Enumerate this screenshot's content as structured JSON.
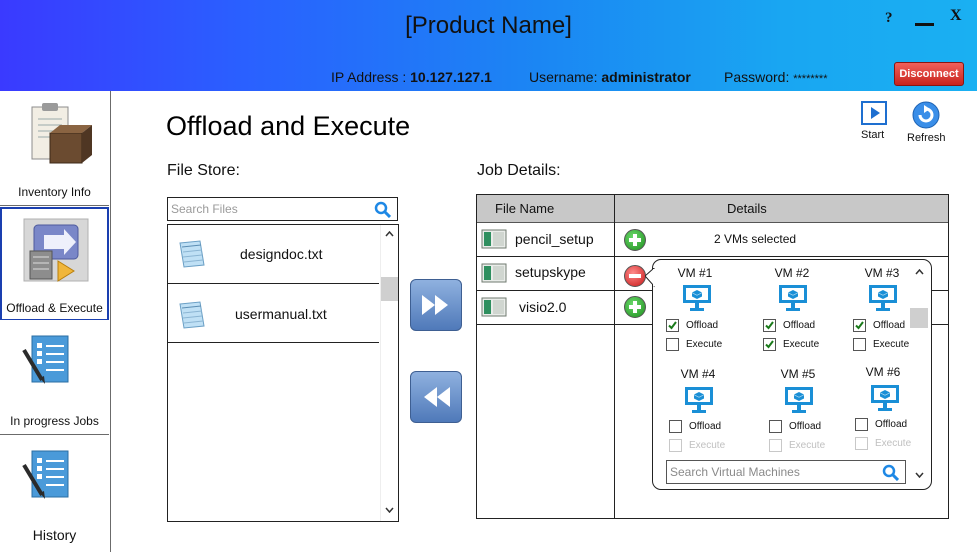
{
  "header": {
    "product_name": "[Product Name]",
    "help": "?",
    "close": "X",
    "ip_label": "IP Address :",
    "ip_value": "10.127.127.1",
    "user_label": "Username:",
    "user_value": "administrator",
    "pass_label": "Password:",
    "pass_value": "********",
    "disconnect": "Disconnect"
  },
  "sidebar": {
    "items": [
      {
        "label": "Inventory Info",
        "icon": "clipboard-box-icon"
      },
      {
        "label": "Offload & Execute",
        "icon": "server-arrow-icon"
      },
      {
        "label": "In progress Jobs",
        "icon": "checklist-pen-icon"
      },
      {
        "label": "History",
        "icon": "checklist-pen-icon"
      }
    ]
  },
  "main": {
    "title": "Offload and Execute",
    "toolbar": {
      "start": "Start",
      "refresh": "Refresh"
    },
    "file_store": {
      "label": "File Store:",
      "search_placeholder": "Search Files",
      "files": [
        "designdoc.txt",
        "usermanual.txt"
      ]
    },
    "job_details": {
      "label": "Job Details:",
      "columns": [
        "File Name",
        "Details"
      ],
      "rows": [
        {
          "name": "pencil_setup",
          "details": "2 VMs selected",
          "action": "add"
        },
        {
          "name": "setupskype",
          "details": "",
          "action": "remove"
        },
        {
          "name": "visio2.0",
          "details": "",
          "action": "add"
        }
      ]
    },
    "vm_popup": {
      "vms": [
        {
          "name": "VM #1",
          "offload": "Offload",
          "execute": "Execute",
          "offload_checked": true,
          "execute_checked": false,
          "execute_enabled": true
        },
        {
          "name": "VM #2",
          "offload": "Offload",
          "execute": "Execute",
          "offload_checked": true,
          "execute_checked": true,
          "execute_enabled": true
        },
        {
          "name": "VM #3",
          "offload": "Offload",
          "execute": "Execute",
          "offload_checked": true,
          "execute_checked": false,
          "execute_enabled": true
        },
        {
          "name": "VM #4",
          "offload": "Offload",
          "execute": "Execute",
          "offload_checked": false,
          "execute_checked": false,
          "execute_enabled": false
        },
        {
          "name": "VM #5",
          "offload": "Offload",
          "execute": "Execute",
          "offload_checked": false,
          "execute_checked": false,
          "execute_enabled": false
        },
        {
          "name": "VM #6",
          "offload": "Offload",
          "execute": "Execute",
          "offload_checked": false,
          "execute_checked": false,
          "execute_enabled": false
        }
      ],
      "search_placeholder": "Search Virtual Machines"
    }
  },
  "colors": {
    "accent": "#1a3fb0",
    "monitor": "#1a8fd6",
    "check": "#1a7a1a",
    "add": "#1f8f1f",
    "remove": "#c81818"
  }
}
